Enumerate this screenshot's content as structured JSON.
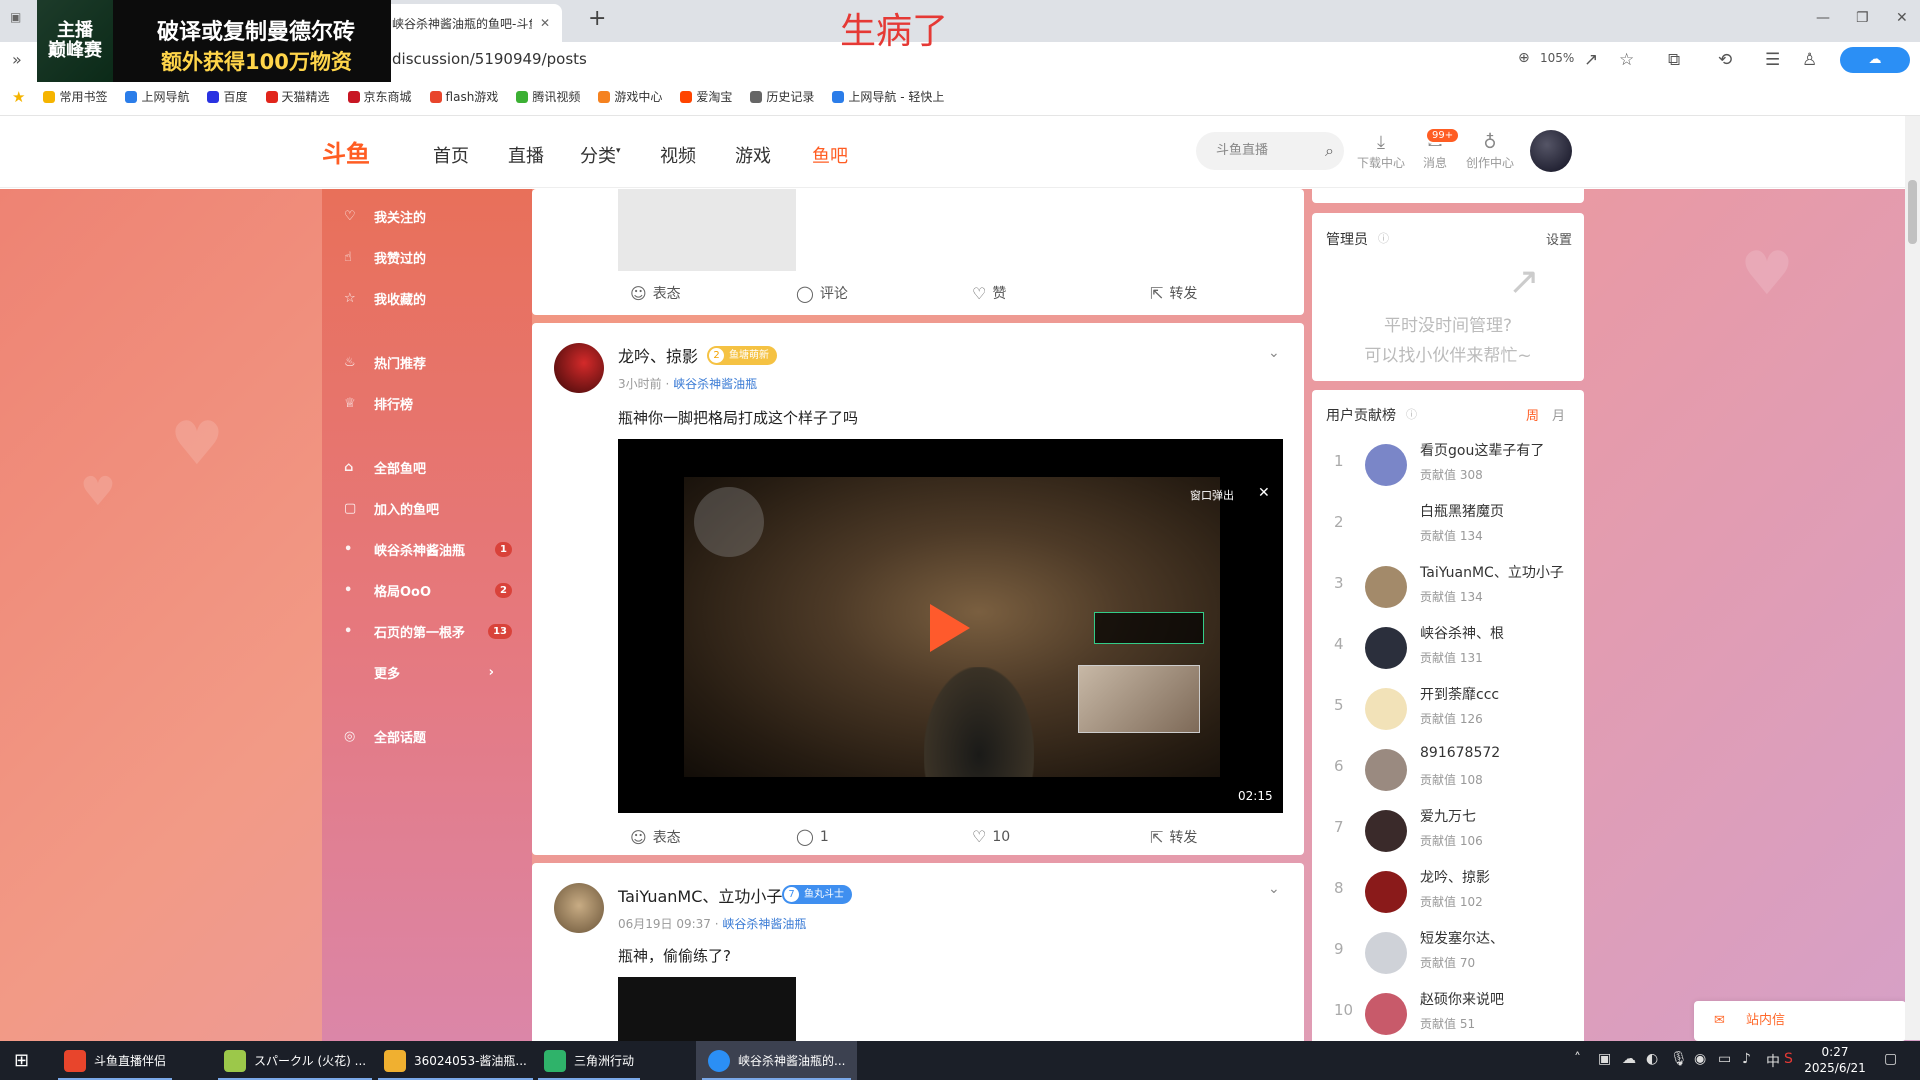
{
  "browser": {
    "tab_title": "峡谷杀神酱油瓶的鱼吧-斗鱼社",
    "new_tab": "+",
    "url": "discussion/5190949/posts",
    "zoom": "105%",
    "ad_line1": "破译或复制曼德尔砖",
    "ad_line2": "额外获得100万物资",
    "ad_logo": "主播\n巅峰赛",
    "overlay_text": "生病了"
  },
  "bookmarks": [
    {
      "label": "常用书签",
      "color": "#f5b400"
    },
    {
      "label": "上网导航",
      "color": "#2b7de9"
    },
    {
      "label": "百度",
      "color": "#2932e1"
    },
    {
      "label": "天猫精选",
      "color": "#e1251b"
    },
    {
      "label": "京东商城",
      "color": "#c81623"
    },
    {
      "label": "flash游戏",
      "color": "#e8452c"
    },
    {
      "label": "腾讯视频",
      "color": "#3cb034"
    },
    {
      "label": "游戏中心",
      "color": "#f58220"
    },
    {
      "label": "爱淘宝",
      "color": "#ff4400"
    },
    {
      "label": "历史记录",
      "color": "#666666"
    },
    {
      "label": "上网导航 - 轻快上",
      "color": "#2b7de9"
    }
  ],
  "header": {
    "logo": "斗鱼",
    "nav": [
      "首页",
      "直播",
      "分类",
      "视频",
      "游戏",
      "鱼吧"
    ],
    "active_nav": "鱼吧",
    "search_placeholder": "斗鱼直播",
    "download": "下载中心",
    "messages": "消息",
    "messages_badge": "99+",
    "creator": "创作中心"
  },
  "sidebar": {
    "items": [
      {
        "label": "我关注的",
        "icon": "heart-outline-icon"
      },
      {
        "label": "我赞过的",
        "icon": "thumb-up-icon"
      },
      {
        "label": "我收藏的",
        "icon": "star-icon"
      },
      {
        "label": "热门推荐",
        "icon": "flame-icon"
      },
      {
        "label": "排行榜",
        "icon": "trophy-icon"
      },
      {
        "label": "全部鱼吧",
        "icon": "home-icon"
      },
      {
        "label": "加入的鱼吧",
        "icon": "note-icon"
      },
      {
        "label": "峡谷杀神酱油瓶",
        "count": "1"
      },
      {
        "label": "格局OoO",
        "count": "2"
      },
      {
        "label": "石页的第一根矛",
        "count": "13"
      },
      {
        "label": "更多"
      },
      {
        "label": "全部话题",
        "icon": "hashtag-icon"
      }
    ]
  },
  "posts": {
    "top_actions": {
      "react": "表态",
      "comment": "评论",
      "like": "赞",
      "share": "转发"
    },
    "post1": {
      "user": "龙吟、掠影",
      "badge_level": "2",
      "badge_text": "鱼塘萌新",
      "time": "3小时前",
      "group": "峡谷杀神酱油瓶",
      "text": "瓶神你一脚把格局打成这个样子了吗",
      "video_popup": "窗口弹出",
      "video_duration": "02:15",
      "react": "表态",
      "comments": "1",
      "likes": "10",
      "share": "转发"
    },
    "post2": {
      "user": "TaiYuanMC、立功小子",
      "badge_level": "7",
      "badge_text": "鱼丸斗士",
      "time": "06月19日 09:37",
      "group": "峡谷杀神酱油瓶",
      "text": "瓶神，偷偷练了?"
    }
  },
  "admin": {
    "title": "管理员",
    "settings": "设置",
    "hint_line1": "平时没时间管理?",
    "hint_line2": "可以找小伙伴来帮忙~"
  },
  "contrib": {
    "title": "用户贡献榜",
    "tab_week": "周",
    "tab_month": "月",
    "label": "贡献值",
    "rows": [
      {
        "rank": "1",
        "name": "看页gou这辈子有了",
        "points": "308",
        "color": "#7a86c8"
      },
      {
        "rank": "2",
        "name": "白瓶黑猪魔页",
        "points": "134",
        "color": "#ffffff"
      },
      {
        "rank": "3",
        "name": "TaiYuanMC、立功小子",
        "points": "134",
        "color": "#a38a6a"
      },
      {
        "rank": "4",
        "name": "峡谷杀神、根",
        "points": "131",
        "color": "#2b2f3c"
      },
      {
        "rank": "5",
        "name": "开到荼靡ccc",
        "points": "126",
        "color": "#f2e2b8"
      },
      {
        "rank": "6",
        "name": "891678572",
        "points": "108",
        "color": "#9a8a80"
      },
      {
        "rank": "7",
        "name": "爱九万七",
        "points": "106",
        "color": "#3a2a2a"
      },
      {
        "rank": "8",
        "name": "龙吟、掠影",
        "points": "102",
        "color": "#8a1a1a"
      },
      {
        "rank": "9",
        "name": "短发塞尔达、",
        "points": "70",
        "color": "#cfd2d8"
      },
      {
        "rank": "10",
        "name": "赵硕你来说吧",
        "points": "51",
        "color": "#c85a6a"
      }
    ]
  },
  "station_msg": "站内信",
  "taskbar": {
    "items": [
      {
        "label": "斗鱼直播伴侣",
        "color": "#e8452c"
      },
      {
        "label": "スパークル (火花) ...",
        "color": "#9cc84a"
      },
      {
        "label": "36024053-酱油瓶...",
        "color": "#f0b030"
      },
      {
        "label": "三角洲行动",
        "color": "#2fb36a"
      },
      {
        "label": "峡谷杀神酱油瓶的...",
        "color": "#2b8ff5"
      }
    ],
    "time": "0:27",
    "date": "2025/6/21",
    "ime": "中"
  }
}
